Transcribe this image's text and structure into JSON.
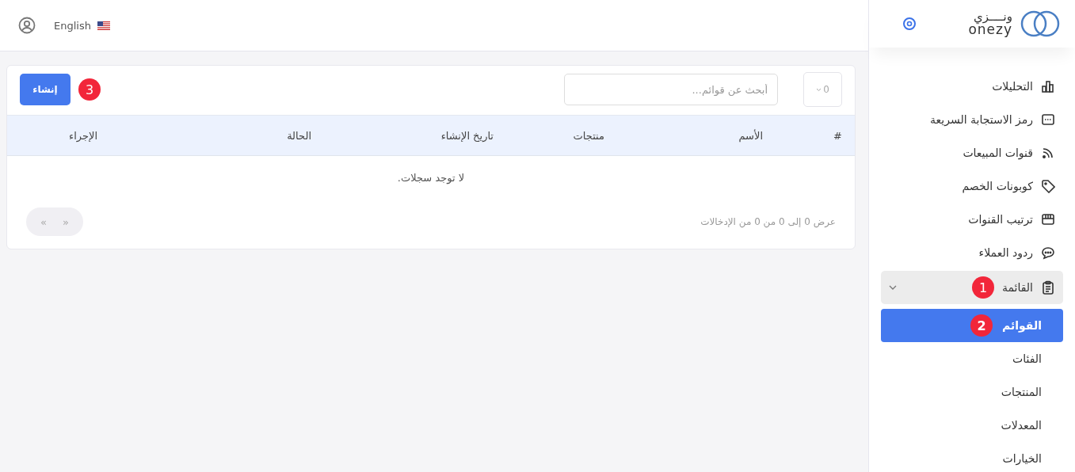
{
  "topbar": {
    "language": "English"
  },
  "sidebar": {
    "logo_arabic": "ونــــزي",
    "logo_latin": "onezy",
    "items": [
      {
        "label": "التحليلات",
        "kind": "chart",
        "expanded": false,
        "selected": false
      },
      {
        "label": "رمز الاستجابة السريعة",
        "kind": "qr",
        "expanded": false,
        "selected": false
      },
      {
        "label": "قنوات المبيعات",
        "kind": "rss",
        "expanded": false,
        "selected": false
      },
      {
        "label": "كوبونات الخصم",
        "kind": "tag",
        "expanded": false,
        "selected": false
      },
      {
        "label": "ترتيب القنوات",
        "kind": "store",
        "expanded": false,
        "selected": false
      },
      {
        "label": "ردود العملاء",
        "kind": "chat",
        "expanded": false,
        "selected": false
      },
      {
        "label": "القائمة",
        "kind": "clipboard",
        "expanded": true,
        "selected": false,
        "badge": "1",
        "children": [
          {
            "label": "القوائم",
            "selected": true,
            "badge": "2"
          },
          {
            "label": "الفئات",
            "selected": false
          },
          {
            "label": "المنتجات",
            "selected": false
          },
          {
            "label": "المعدلات",
            "selected": false
          },
          {
            "label": "الخيارات",
            "selected": false
          }
        ]
      }
    ]
  },
  "toolbar": {
    "page_size": "0",
    "search": {
      "placeholder": "أبحث عن قوائم..."
    },
    "create_button": "إنشاء",
    "create_badge": "3"
  },
  "table": {
    "columns": [
      "#",
      "الأسم",
      "منتجات",
      "تاريخ الإنشاء",
      "الحالة",
      "الإجراء"
    ],
    "empty_message": "لا توجد سجلات."
  },
  "footer": {
    "info": "عرض 0 إلى 0 من 0 من الإدخالات",
    "pager": [
      "«",
      "»"
    ]
  }
}
